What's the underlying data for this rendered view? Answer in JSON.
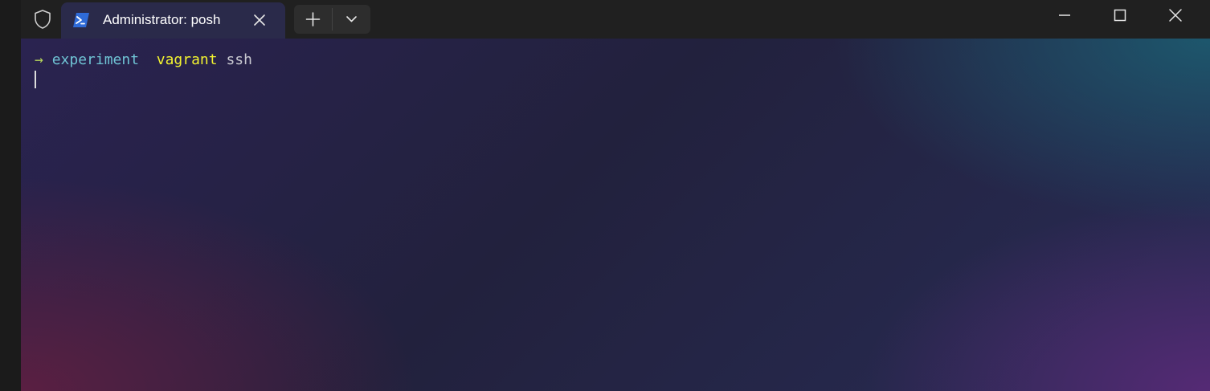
{
  "titlebar": {
    "tab": {
      "title": "Administrator: posh",
      "icon": "powershell-icon"
    },
    "buttons": {
      "new_tab_icon": "plus-icon",
      "dropdown_icon": "chevron-down-icon",
      "minimize_icon": "minimize-icon",
      "maximize_icon": "maximize-icon",
      "close_icon": "close-icon"
    }
  },
  "terminal": {
    "prompt_arrow": "→",
    "directory": "experiment",
    "command": "vagrant",
    "arguments": "ssh"
  },
  "colors": {
    "tab_background": "#2a2a4a",
    "prompt_arrow": "#b7d65c",
    "directory": "#6fc3d4",
    "command": "#f2f230",
    "arguments": "#c8c8d0"
  }
}
